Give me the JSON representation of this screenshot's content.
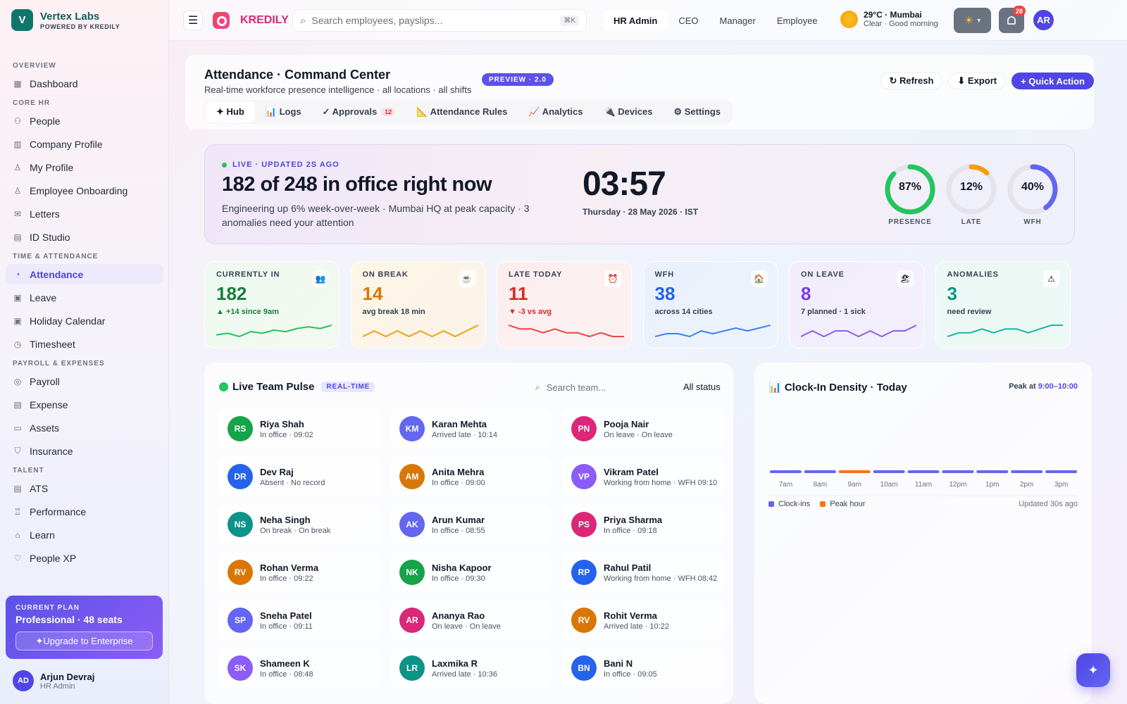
{
  "brand": {
    "initial": "V",
    "name": "Vertex Labs",
    "sub": "POWERED BY KREDILY"
  },
  "nav": [
    {
      "section": "OVERVIEW",
      "items": [
        {
          "label": "Dashboard",
          "icon": "grid-icon",
          "glyph": "▦"
        }
      ]
    },
    {
      "section": "CORE HR",
      "items": [
        {
          "label": "People",
          "icon": "people-icon",
          "glyph": "⚇"
        },
        {
          "label": "Company Profile",
          "icon": "building-icon",
          "glyph": "▥"
        },
        {
          "label": "My Profile",
          "icon": "user-icon",
          "glyph": "♙"
        },
        {
          "label": "Employee Onboarding",
          "icon": "user-plus-icon",
          "glyph": "♙"
        },
        {
          "label": "Letters",
          "icon": "mail-icon",
          "glyph": "✉"
        },
        {
          "label": "ID Studio",
          "icon": "id-card-icon",
          "glyph": "▤"
        }
      ]
    },
    {
      "section": "TIME & ATTENDANCE",
      "items": [
        {
          "label": "Attendance",
          "icon": "clock-icon",
          "glyph": "◔",
          "active": true
        },
        {
          "label": "Leave",
          "icon": "calendar-icon",
          "glyph": "▣"
        },
        {
          "label": "Holiday Calendar",
          "icon": "calendar-icon",
          "glyph": "▣"
        },
        {
          "label": "Timesheet",
          "icon": "timer-icon",
          "glyph": "◷"
        }
      ]
    },
    {
      "section": "PAYROLL & EXPENSES",
      "items": [
        {
          "label": "Payroll",
          "icon": "coin-icon",
          "glyph": "◎"
        },
        {
          "label": "Expense",
          "icon": "receipt-icon",
          "glyph": "▤"
        },
        {
          "label": "Assets",
          "icon": "monitor-icon",
          "glyph": "▭"
        },
        {
          "label": "Insurance",
          "icon": "shield-icon",
          "glyph": "⛉"
        }
      ]
    },
    {
      "section": "TALENT",
      "items": [
        {
          "label": "ATS",
          "icon": "clipboard-icon",
          "glyph": "▤"
        },
        {
          "label": "Performance",
          "icon": "trophy-icon",
          "glyph": "♖"
        },
        {
          "label": "Learn",
          "icon": "graduation-cap-icon",
          "glyph": "⌂"
        },
        {
          "label": "People XP",
          "icon": "heart-icon",
          "glyph": "♡"
        }
      ]
    }
  ],
  "plan": {
    "label": "CURRENT PLAN",
    "name": "Professional · 48 seats",
    "button": "✦Upgrade to Enterprise"
  },
  "user": {
    "initials": "AD",
    "name": "Arjun Devraj",
    "role": "HR Admin"
  },
  "topbar": {
    "logo": "KREDILY",
    "search_placeholder": "Search employees, payslips...",
    "kbd": "⌘K",
    "roles": [
      "HR Admin",
      "CEO",
      "Manager",
      "Employee"
    ],
    "active_role": "HR Admin",
    "weather_title": "29°C · Mumbai",
    "weather_sub": "Clear · Good morning",
    "theme_icon": "☀",
    "notifications": "28",
    "avatar": "AR"
  },
  "page": {
    "title": "Attendance · Command Center",
    "subtitle": "Real-time workforce presence intelligence · all locations · all shifts",
    "preview": "PREVIEW · 2.0",
    "buttons": [
      {
        "label": "↻ Refresh"
      },
      {
        "label": "⬇ Export"
      },
      {
        "label": "+ Quick Action"
      }
    ],
    "tabs": [
      {
        "label": "✦ Hub",
        "active": true
      },
      {
        "label": "📊 Logs"
      },
      {
        "label": "✓ Approvals",
        "count": "12"
      },
      {
        "label": "📐 Attendance Rules"
      },
      {
        "label": "📈 Analytics"
      },
      {
        "label": "🔌 Devices"
      },
      {
        "label": "⚙ Settings"
      }
    ]
  },
  "hero": {
    "live": "LIVE · UPDATED 2S AGO",
    "headline": "182 of 248 in office right now",
    "sub": "Engineering up 6% week-over-week · Mumbai HQ at peak capacity · 3 anomalies need your attention",
    "clock": "03:57",
    "date": "Thursday · 28 May 2026 · IST",
    "rings": [
      {
        "value": "87%",
        "pct": 87,
        "label": "PRESENCE",
        "color": "#22c55e"
      },
      {
        "value": "12%",
        "pct": 12,
        "label": "LATE",
        "color": "#f59e0b"
      },
      {
        "value": "40%",
        "pct": 40,
        "label": "WFH",
        "color": "#6366f1"
      }
    ]
  },
  "stats": [
    {
      "label": "CURRENTLY IN",
      "value": "182",
      "detail": "▲ +14 since 9am",
      "icon": "👥",
      "color": "#15803d",
      "detail_color": "#15803d",
      "line": "#22c55e",
      "bg": "linear-gradient(135deg,#eef9f0,#f3f9ef)",
      "trend": [
        4,
        5,
        3,
        6,
        5,
        7,
        6,
        8,
        9,
        8,
        10
      ]
    },
    {
      "label": "ON BREAK",
      "value": "14",
      "detail": "avg break 18 min",
      "icon": "☕",
      "color": "#d97706",
      "detail_color": "#374151",
      "line": "#f59e0b",
      "bg": "linear-gradient(135deg,#fdf6e7,#fbf3ea)",
      "trend": [
        5,
        6,
        5,
        6,
        5,
        6,
        5,
        6,
        5,
        6,
        7
      ]
    },
    {
      "label": "LATE TODAY",
      "value": "11",
      "detail": "▼ -3 vs avg",
      "icon": "⏰",
      "color": "#dc2626",
      "detail_color": "#dc2626",
      "line": "#ef4444",
      "bg": "linear-gradient(135deg,#fdeeee,#fbf0f1)",
      "trend": [
        8,
        7,
        7,
        6,
        7,
        6,
        6,
        5,
        6,
        5,
        5
      ]
    },
    {
      "label": "WFH",
      "value": "38",
      "detail": "across 14 cities",
      "icon": "🏠",
      "color": "#2563eb",
      "detail_color": "#374151",
      "line": "#3b82f6",
      "bg": "linear-gradient(135deg,#eaf1fc,#eef2fb)",
      "trend": [
        5,
        6,
        6,
        5,
        7,
        6,
        7,
        8,
        7,
        8,
        9
      ]
    },
    {
      "label": "ON LEAVE",
      "value": "8",
      "detail": "7 planned · 1 sick",
      "icon": "🏖",
      "color": "#7c3aed",
      "detail_color": "#374151",
      "line": "#8b5cf6",
      "bg": "linear-gradient(135deg,#f2edfb,#f3eefb)",
      "trend": [
        5,
        6,
        5,
        6,
        6,
        5,
        6,
        5,
        6,
        6,
        7
      ]
    },
    {
      "label": "ANOMALIES",
      "value": "3",
      "detail": "need review",
      "icon": "⚠",
      "color": "#0d9488",
      "detail_color": "#374151",
      "line": "#14b8a6",
      "bg": "linear-gradient(135deg,#ebf8f5,#eef8f4)",
      "trend": [
        4,
        5,
        5,
        6,
        5,
        6,
        6,
        5,
        6,
        7,
        7
      ]
    }
  ],
  "pulse": {
    "title": "Live Team Pulse",
    "badge": "REAL-TIME",
    "search_placeholder": "Search team...",
    "filter": "All status",
    "members": [
      {
        "initials": "RS",
        "name": "Riya Shah",
        "status": "In office · 09:02",
        "bg": "#16a34a",
        "dot": "#22c55e"
      },
      {
        "initials": "KM",
        "name": "Karan Mehta",
        "status": "Arrived late · 10:14",
        "bg": "#6366f1",
        "dot": "#f59e0b"
      },
      {
        "initials": "PN",
        "name": "Pooja Nair",
        "status": "On leave · On leave",
        "bg": "#db2777",
        "dot": "#3b82f6"
      },
      {
        "initials": "DR",
        "name": "Dev Raj",
        "status": "Absent · No record",
        "bg": "#2563eb",
        "dot": "#ef4444"
      },
      {
        "initials": "AM",
        "name": "Anita Mehra",
        "status": "In office · 09:00",
        "bg": "#d97706",
        "dot": "#22c55e"
      },
      {
        "initials": "VP",
        "name": "Vikram Patel",
        "status": "Working from home · WFH 09:10",
        "bg": "#8b5cf6",
        "dot": "#3b82f6"
      },
      {
        "initials": "NS",
        "name": "Neha Singh",
        "status": "On break · On break",
        "bg": "#0d9488",
        "dot": "#f59e0b"
      },
      {
        "initials": "AK",
        "name": "Arun Kumar",
        "status": "In office · 08:55",
        "bg": "#6366f1",
        "dot": "#22c55e"
      },
      {
        "initials": "PS",
        "name": "Priya Sharma",
        "status": "In office · 09:18",
        "bg": "#db2777",
        "dot": "#22c55e"
      },
      {
        "initials": "RV",
        "name": "Rohan Verma",
        "status": "In office · 09:22",
        "bg": "#d97706",
        "dot": "#22c55e"
      },
      {
        "initials": "NK",
        "name": "Nisha Kapoor",
        "status": "In office · 09:30",
        "bg": "#16a34a",
        "dot": "#22c55e"
      },
      {
        "initials": "RP",
        "name": "Rahul Patil",
        "status": "Working from home · WFH 08:42",
        "bg": "#2563eb",
        "dot": "#3b82f6"
      },
      {
        "initials": "SP",
        "name": "Sneha Patel",
        "status": "In office · 09:11",
        "bg": "#6366f1",
        "dot": "#22c55e"
      },
      {
        "initials": "AR",
        "name": "Ananya Rao",
        "status": "On leave · On leave",
        "bg": "#db2777",
        "dot": "#3b82f6"
      },
      {
        "initials": "RV",
        "name": "Rohit Verma",
        "status": "Arrived late · 10:22",
        "bg": "#d97706",
        "dot": "#f59e0b"
      },
      {
        "initials": "SK",
        "name": "Shameen K",
        "status": "In office · 08:48",
        "bg": "#8b5cf6",
        "dot": "#22c55e"
      },
      {
        "initials": "LR",
        "name": "Laxmika R",
        "status": "Arrived late · 10:36",
        "bg": "#0d9488",
        "dot": "#f59e0b"
      },
      {
        "initials": "BN",
        "name": "Bani N",
        "status": "In office · 09:05",
        "bg": "#2563eb",
        "dot": "#22c55e"
      }
    ]
  },
  "density": {
    "title": "📊 Clock-In Density · Today",
    "peak_label": "Peak at",
    "peak_value": "9:00–10:00",
    "legend_clockins": "Clock-ins",
    "legend_peak": "Peak hour",
    "updated": "Updated 30s ago"
  },
  "chart_data": {
    "type": "bar",
    "title": "Clock-In Density · Today",
    "categories": [
      "7am",
      "8am",
      "9am",
      "10am",
      "11am",
      "12pm",
      "1pm",
      "2pm",
      "3pm"
    ],
    "series": [
      {
        "name": "Clock-ins"
      }
    ],
    "peak": "9am",
    "colors": {
      "bar": "#6366f1",
      "peak": "#f97316"
    }
  },
  "fab": {
    "icon": "✦"
  }
}
